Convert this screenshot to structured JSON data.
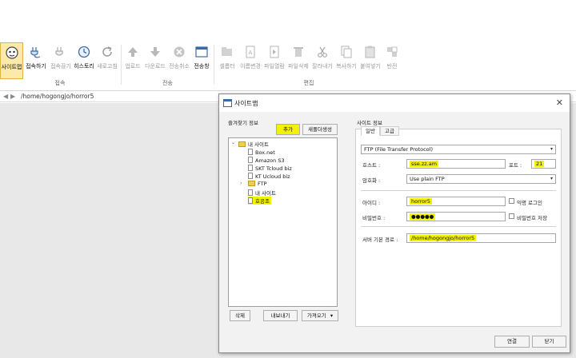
{
  "ribbon": {
    "groups": {
      "connect": "접속",
      "transfer": "전송",
      "edit": "편집"
    },
    "buttons": {
      "sitemap": "사이트맵",
      "connect": "접속하기",
      "disconnect": "접속끊기",
      "history": "히스토리",
      "refresh": "새로고침",
      "upload": "업로드",
      "download": "다운로드",
      "transfer_cancel": "전송취소",
      "transfer_window": "전송창",
      "select_all": "셀롭터",
      "rename": "이름변경",
      "open_file": "파일열람",
      "delete_file": "파일삭제",
      "cut": "잘라내기",
      "copy": "복사하기",
      "paste": "붙여넣기",
      "invert": "반전"
    }
  },
  "pathbar": {
    "back": "◀",
    "forward": "▶",
    "path": "/home/hogongjo/horror5"
  },
  "dialog": {
    "title": "사이트맵",
    "close": "✕",
    "bookmark_info_label": "즐겨찾기 정보",
    "add_button": "추가",
    "new_folder_button": "새폴더생성",
    "tree": {
      "root": "내 사이트",
      "items": [
        "Box.net",
        "Amazon S3",
        "SKT Tcloud biz",
        "KT Ucloud biz"
      ],
      "ftp_folder": "FTP",
      "my_site": "내 사이트",
      "selected_site": "호공조"
    },
    "delete_button": "삭제",
    "export_button": "내보내기",
    "import_button": "가져오기",
    "site_info_label": "사이트 정보",
    "tabs": [
      "일반",
      "고급"
    ],
    "protocol": "FTP (File Transfer Protocol)",
    "host_label": "호스트 :",
    "host_value": "sse.zz.am",
    "port_label": "포트 :",
    "port_value": "21",
    "encryption_label": "암호화 :",
    "encryption_value": "Use plain FTP",
    "id_label": "아이디 :",
    "id_value": "horror5",
    "anonymous_label": "익명 로그인",
    "password_label": "비밀번호 :",
    "password_value": "●●●●●",
    "save_password_label": "비밀번호 저장",
    "server_path_label": "서버 기본 경로 :",
    "server_path_value": "/home/hogongjo/horror5",
    "connect_button": "연결",
    "close_button": "닫기"
  },
  "colors": {
    "highlight": "#f5f200",
    "ribbon_active": "#fde9a8",
    "folder": "#f2cc5a"
  }
}
